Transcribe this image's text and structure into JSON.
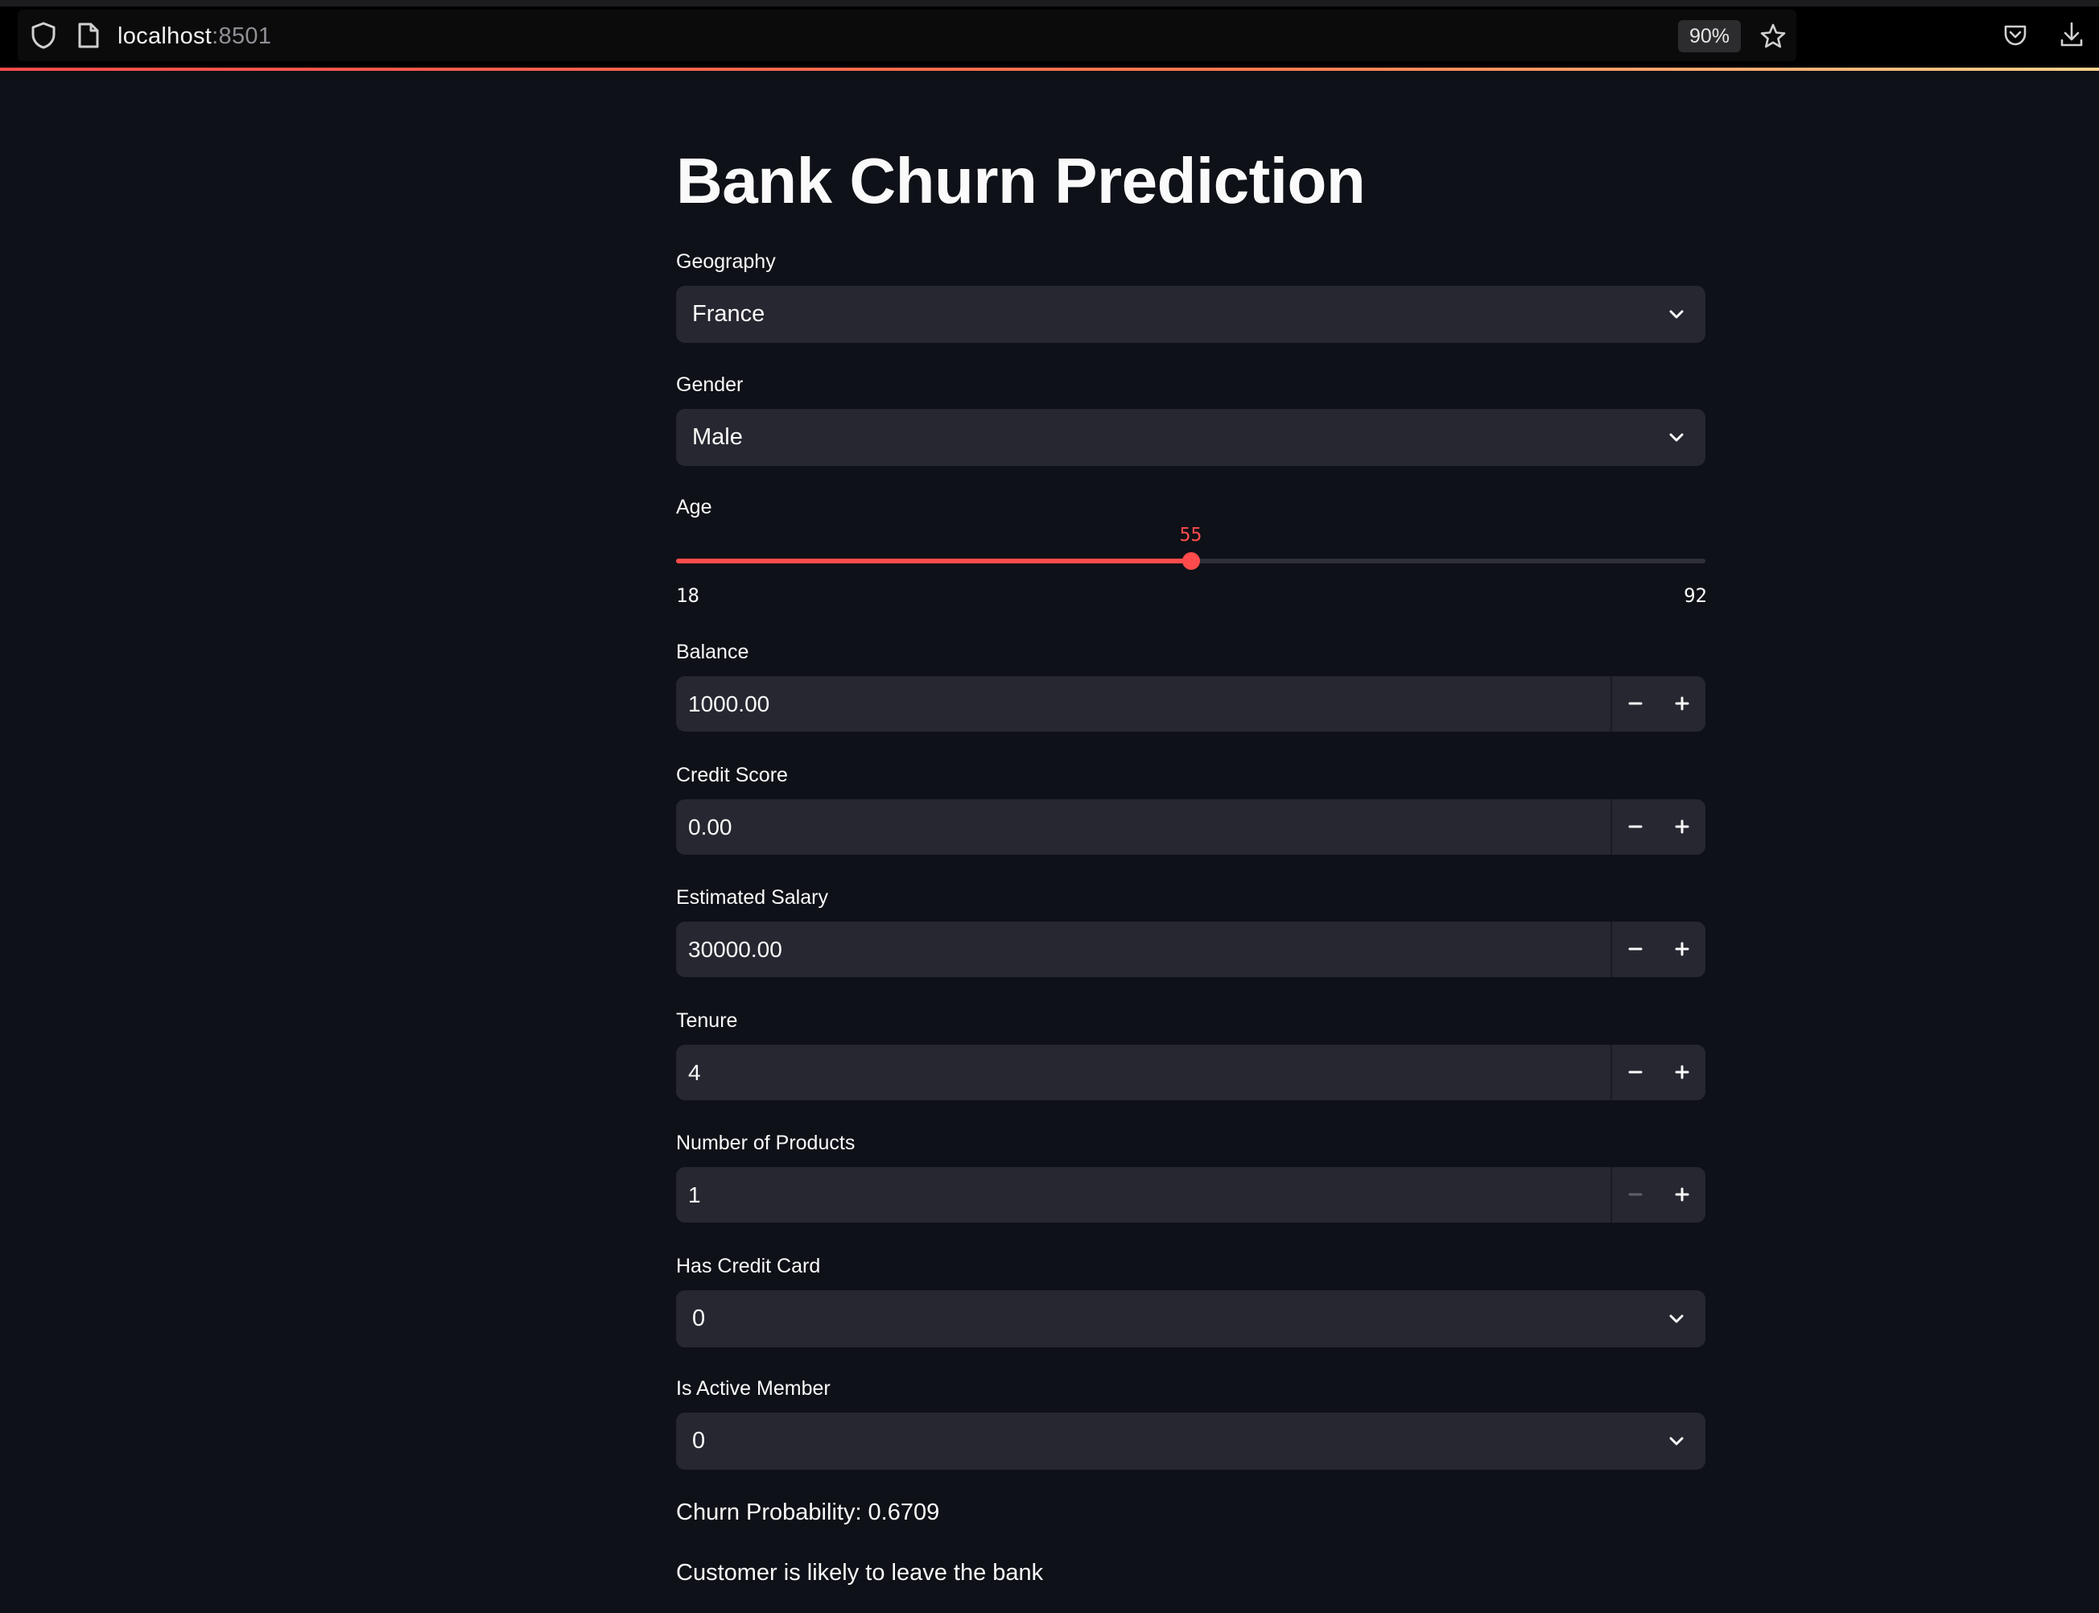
{
  "browser": {
    "url_host": "localhost",
    "url_port": ":8501",
    "zoom": "90%",
    "accent_gradient": [
      "#ff4b4b",
      "#ffd18a"
    ]
  },
  "app": {
    "title": "Bank Churn Prediction",
    "accent_color": "#ff4b4b",
    "background": "#0e1117",
    "input_background": "#262730"
  },
  "fields": {
    "geography": {
      "label": "Geography",
      "value": "France"
    },
    "gender": {
      "label": "Gender",
      "value": "Male"
    },
    "age": {
      "label": "Age",
      "value": "55",
      "min": "18",
      "max": "92"
    },
    "balance": {
      "label": "Balance",
      "value": "1000.00"
    },
    "credit_score": {
      "label": "Credit Score",
      "value": "0.00"
    },
    "estimated_salary": {
      "label": "Estimated Salary",
      "value": "30000.00"
    },
    "tenure": {
      "label": "Tenure",
      "value": "4"
    },
    "num_products": {
      "label": "Number of Products",
      "value": "1"
    },
    "has_credit_card": {
      "label": "Has Credit Card",
      "value": "0"
    },
    "is_active_member": {
      "label": "Is Active Member",
      "value": "0"
    }
  },
  "result": {
    "probability_text": "Churn Probability: 0.6709",
    "verdict_text": "Customer is likely to leave the bank"
  },
  "icons": {
    "shield": "shield-icon",
    "page": "page-icon",
    "star": "star-icon",
    "pocket": "pocket-icon",
    "download": "download-icon",
    "chevron": "chevron-down-icon",
    "minus": "minus-icon",
    "plus": "plus-icon"
  }
}
